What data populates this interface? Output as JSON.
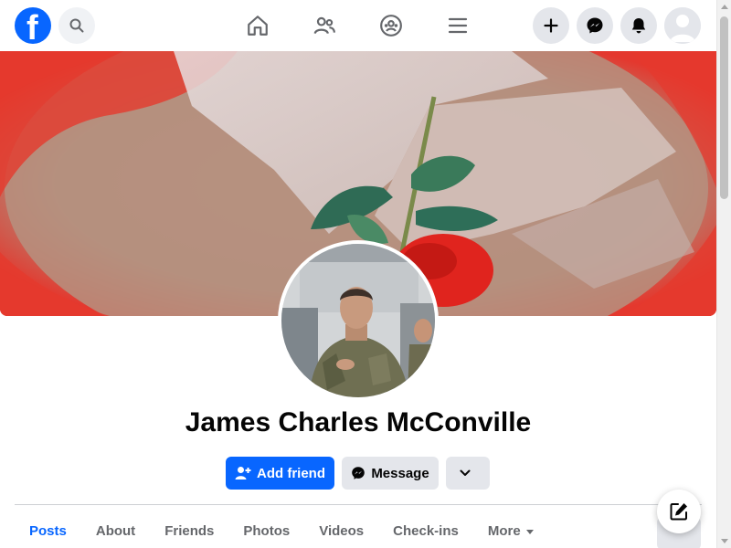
{
  "topbar": {
    "logo": "facebook-logo",
    "logo_glyph": "f",
    "search_icon": "search-icon",
    "nav_icons": [
      "home-icon",
      "friends-icon",
      "groups-icon",
      "menu-icon"
    ],
    "right_icons": [
      "plus-icon",
      "messenger-icon",
      "bell-icon",
      "avatar-icon"
    ]
  },
  "profile": {
    "name": "James Charles McConville",
    "cover_description_icon": "cover-photo",
    "profile_picture_icon": "profile-picture"
  },
  "actions": {
    "add_friend_label": "Add friend",
    "message_label": "Message"
  },
  "tabs": [
    {
      "label": "Posts",
      "active": true
    },
    {
      "label": "About",
      "active": false
    },
    {
      "label": "Friends",
      "active": false
    },
    {
      "label": "Photos",
      "active": false
    },
    {
      "label": "Videos",
      "active": false
    },
    {
      "label": "Check-ins",
      "active": false
    },
    {
      "label": "More",
      "active": false
    }
  ],
  "colors": {
    "brand_blue": "#0866ff",
    "button_gray": "#e4e6eb",
    "tab_text": "#65676b"
  }
}
